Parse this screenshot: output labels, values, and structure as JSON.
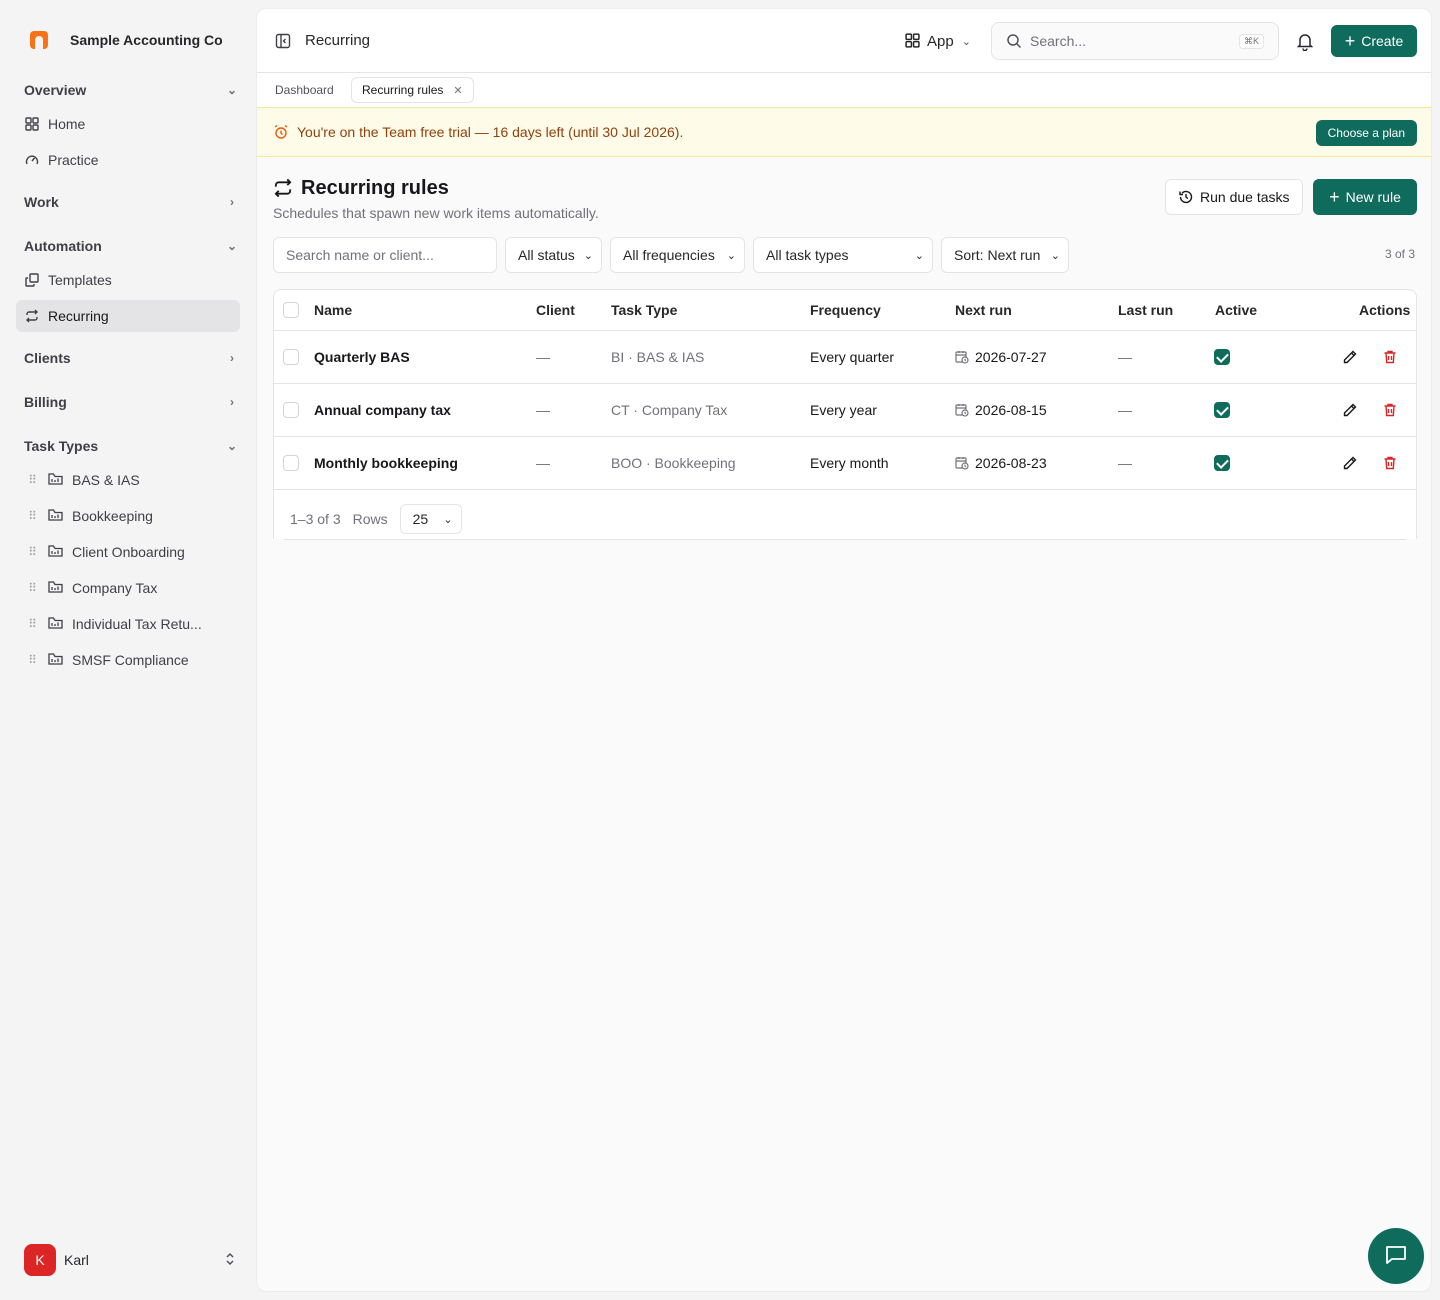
{
  "org": {
    "name": "Sample Accounting Co"
  },
  "sidebar": {
    "overview": {
      "label": "Overview",
      "items": [
        {
          "label": "Home"
        },
        {
          "label": "Practice"
        }
      ]
    },
    "work": {
      "label": "Work"
    },
    "automation": {
      "label": "Automation",
      "items": [
        {
          "label": "Templates"
        },
        {
          "label": "Recurring"
        }
      ]
    },
    "clients": {
      "label": "Clients"
    },
    "billing": {
      "label": "Billing"
    },
    "task_types": {
      "label": "Task Types",
      "items": [
        {
          "label": "BAS & IAS"
        },
        {
          "label": "Bookkeeping"
        },
        {
          "label": "Client Onboarding"
        },
        {
          "label": "Company Tax"
        },
        {
          "label": "Individual Tax Retu..."
        },
        {
          "label": "SMSF Compliance"
        }
      ]
    }
  },
  "user": {
    "initial": "K",
    "name": "Karl"
  },
  "topbar": {
    "title": "Recurring",
    "app_label": "App",
    "search_placeholder": "Search...",
    "shortcut": "⌘K",
    "create_label": "Create"
  },
  "tabs": [
    {
      "label": "Dashboard"
    },
    {
      "label": "Recurring rules"
    }
  ],
  "banner": {
    "text": "You're on the Team free trial — 16 days left (until 30 Jul 2026).",
    "button": "Choose a plan"
  },
  "page": {
    "title": "Recurring rules",
    "subtitle": "Schedules that spawn new work items automatically.",
    "run_button": "Run due tasks",
    "new_button": "New rule"
  },
  "filters": {
    "search_placeholder": "Search name or client...",
    "status": "All status",
    "frequency": "All frequencies",
    "task_type": "All task types",
    "sort": "Sort: Next run",
    "count": "3 of 3"
  },
  "table": {
    "columns": {
      "name": "Name",
      "client": "Client",
      "task_type": "Task Type",
      "frequency": "Frequency",
      "next_run": "Next run",
      "last_run": "Last run",
      "active": "Active",
      "actions": "Actions"
    },
    "rows": [
      {
        "name": "Quarterly BAS",
        "client": "—",
        "task_type": "BI · BAS & IAS",
        "frequency": "Every quarter",
        "next_run": "2026-07-27",
        "last_run": "—",
        "active": true
      },
      {
        "name": "Annual company tax",
        "client": "—",
        "task_type": "CT · Company Tax",
        "frequency": "Every year",
        "next_run": "2026-08-15",
        "last_run": "—",
        "active": true
      },
      {
        "name": "Monthly bookkeeping",
        "client": "—",
        "task_type": "BOO · Bookkeeping",
        "frequency": "Every month",
        "next_run": "2026-08-23",
        "last_run": "—",
        "active": true
      }
    ]
  },
  "pagination": {
    "range": "1–3 of 3",
    "rows_label": "Rows",
    "rows_value": "25"
  },
  "colors": {
    "accent": "#0f6b5c",
    "danger": "#dc2626",
    "banner_bg": "#fefce8",
    "banner_text": "#92400e"
  }
}
